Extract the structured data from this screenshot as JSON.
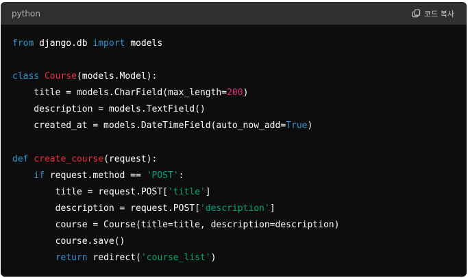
{
  "header": {
    "language": "python",
    "copy_label": "코드 복사",
    "copy_icon": "copy-icon"
  },
  "colors": {
    "keyword": "#2e95d3",
    "class_name": "#f22c3d",
    "number": "#df3079",
    "string": "#00a67d",
    "text": "#ffffff",
    "background": "#0d0d0d",
    "header_background": "#2f2f2f"
  },
  "code": {
    "lines": [
      [
        {
          "t": "from",
          "c": "kw"
        },
        {
          "t": " django.db "
        },
        {
          "t": "import",
          "c": "kw"
        },
        {
          "t": " models"
        }
      ],
      [],
      [
        {
          "t": "class",
          "c": "kw"
        },
        {
          "t": " "
        },
        {
          "t": "Course",
          "c": "cls"
        },
        {
          "t": "(models.Model):"
        }
      ],
      [
        {
          "t": "    title = models.CharField(max_length="
        },
        {
          "t": "200",
          "c": "num"
        },
        {
          "t": ")"
        }
      ],
      [
        {
          "t": "    description = models.TextField()"
        }
      ],
      [
        {
          "t": "    created_at = models.DateTimeField(auto_now_add="
        },
        {
          "t": "True",
          "c": "kw"
        },
        {
          "t": ")"
        }
      ],
      [],
      [
        {
          "t": "def",
          "c": "kw"
        },
        {
          "t": " "
        },
        {
          "t": "create_course",
          "c": "cls"
        },
        {
          "t": "(request):"
        }
      ],
      [
        {
          "t": "    "
        },
        {
          "t": "if",
          "c": "kw"
        },
        {
          "t": " request.method == "
        },
        {
          "t": "'POST'",
          "c": "str"
        },
        {
          "t": ":"
        }
      ],
      [
        {
          "t": "        title = request.POST["
        },
        {
          "t": "'title'",
          "c": "str"
        },
        {
          "t": "]"
        }
      ],
      [
        {
          "t": "        description = request.POST["
        },
        {
          "t": "'description'",
          "c": "str"
        },
        {
          "t": "]"
        }
      ],
      [
        {
          "t": "        course = Course(title=title, description=description)"
        }
      ],
      [
        {
          "t": "        course.save()"
        }
      ],
      [
        {
          "t": "        "
        },
        {
          "t": "return",
          "c": "kw"
        },
        {
          "t": " redirect("
        },
        {
          "t": "'course_list'",
          "c": "str"
        },
        {
          "t": ")"
        }
      ]
    ]
  }
}
